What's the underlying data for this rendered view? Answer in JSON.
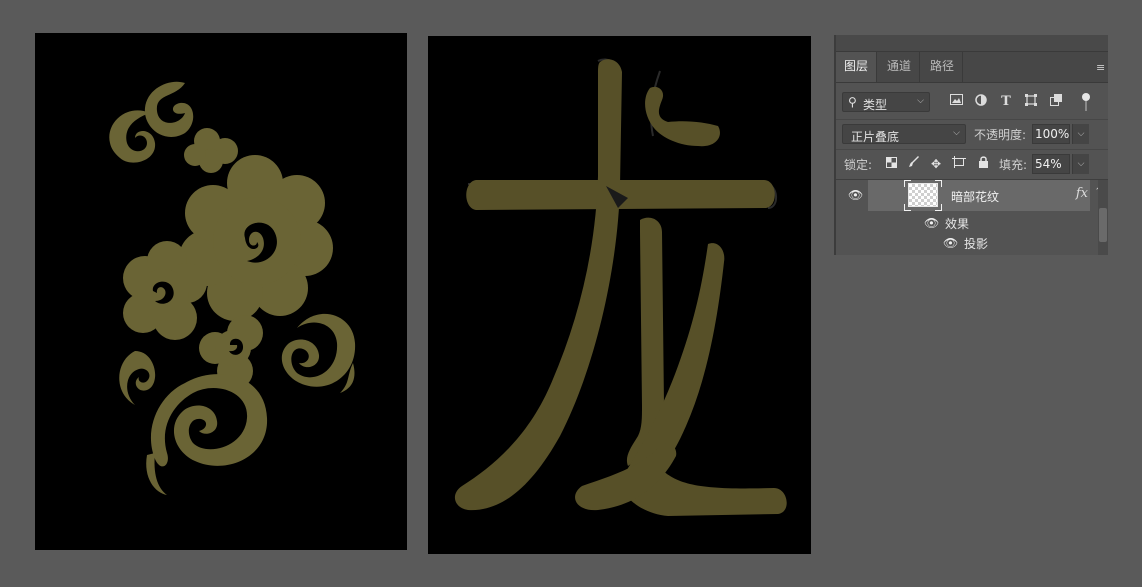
{
  "colors": {
    "background": "#5a5a5a",
    "canvas": "#000000",
    "pattern_fill": "#6a6435",
    "panel_bg": "#535353",
    "selected_layer": "#696969"
  },
  "layers_panel": {
    "tabs": [
      {
        "label": "图层",
        "active": true
      },
      {
        "label": "通道",
        "active": false
      },
      {
        "label": "路径",
        "active": false
      }
    ],
    "menu_icon": "panel-menu-icon",
    "filter": {
      "kind_label": "类型",
      "icons": [
        "pixel-filter-icon",
        "adjustment-filter-icon",
        "type-filter-icon",
        "shape-filter-icon",
        "smart-object-filter-icon"
      ]
    },
    "blend_mode": "正片叠底",
    "opacity_label": "不透明度:",
    "opacity_value": "100%",
    "lock_label": "锁定:",
    "lock_icons": [
      "lock-transparent-icon",
      "lock-image-icon",
      "lock-position-icon",
      "lock-artboard-icon",
      "lock-all-icon"
    ],
    "fill_label": "填充:",
    "fill_value": "54%",
    "layers": [
      {
        "name": "暗部花纹",
        "visible": true,
        "fx": "fx",
        "effects_label": "效果",
        "effects": [
          {
            "name": "投影",
            "visible": true
          }
        ]
      }
    ]
  }
}
